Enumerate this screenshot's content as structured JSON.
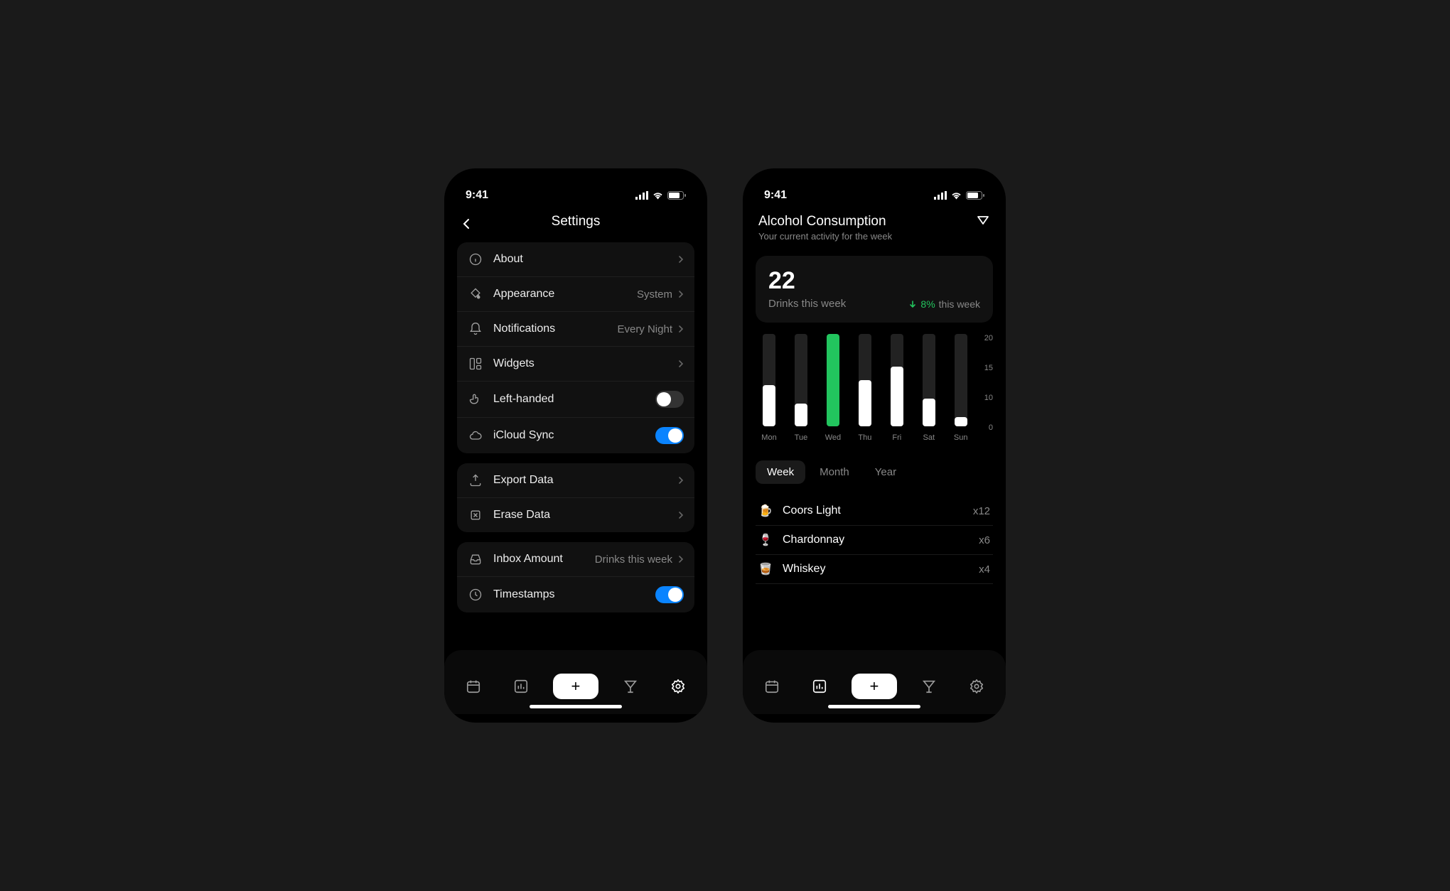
{
  "status_bar": {
    "time": "9:41"
  },
  "settings": {
    "title": "Settings",
    "groups": [
      [
        {
          "icon": "info",
          "label": "About",
          "value": "",
          "type": "link"
        },
        {
          "icon": "paint",
          "label": "Appearance",
          "value": "System",
          "type": "link"
        },
        {
          "icon": "bell",
          "label": "Notifications",
          "value": "Every Night",
          "type": "link"
        },
        {
          "icon": "widgets",
          "label": "Widgets",
          "value": "",
          "type": "link"
        },
        {
          "icon": "hand",
          "label": "Left-handed",
          "on": false,
          "type": "toggle"
        },
        {
          "icon": "cloud",
          "label": "iCloud Sync",
          "on": true,
          "type": "toggle"
        }
      ],
      [
        {
          "icon": "export",
          "label": "Export Data",
          "value": "",
          "type": "link"
        },
        {
          "icon": "trash",
          "label": "Erase Data",
          "value": "",
          "type": "link"
        }
      ],
      [
        {
          "icon": "inbox",
          "label": "Inbox Amount",
          "value": "Drinks this week",
          "type": "link"
        },
        {
          "icon": "clock",
          "label": "Timestamps",
          "on": true,
          "type": "toggle"
        }
      ]
    ]
  },
  "analytics": {
    "title": "Alcohol Consumption",
    "subtitle": "Your current activity for the week",
    "stat": {
      "value": "22",
      "label": "Drinks this week",
      "change_pct": "8%",
      "change_dir": "down",
      "change_period": "this week"
    },
    "segment": {
      "options": [
        "Week",
        "Month",
        "Year"
      ],
      "active": 0
    },
    "drinks": [
      {
        "emoji": "🍺",
        "name": "Coors Light",
        "count": "x12"
      },
      {
        "emoji": "🍷",
        "name": "Chardonnay",
        "count": "x6"
      },
      {
        "emoji": "🥃",
        "name": "Whiskey",
        "count": "x4"
      }
    ]
  },
  "colors": {
    "accent_green": "#22c55e",
    "accent_blue": "#0a84ff"
  },
  "chart_data": {
    "type": "bar",
    "categories": [
      "Mon",
      "Tue",
      "Wed",
      "Thu",
      "Fri",
      "Sat",
      "Sun"
    ],
    "values": [
      9,
      5,
      20,
      10,
      13,
      6,
      2
    ],
    "highlight_index": 2,
    "ylim": [
      0,
      20
    ],
    "yticks": [
      20,
      15,
      10,
      0
    ],
    "title": "",
    "xlabel": "",
    "ylabel": ""
  }
}
